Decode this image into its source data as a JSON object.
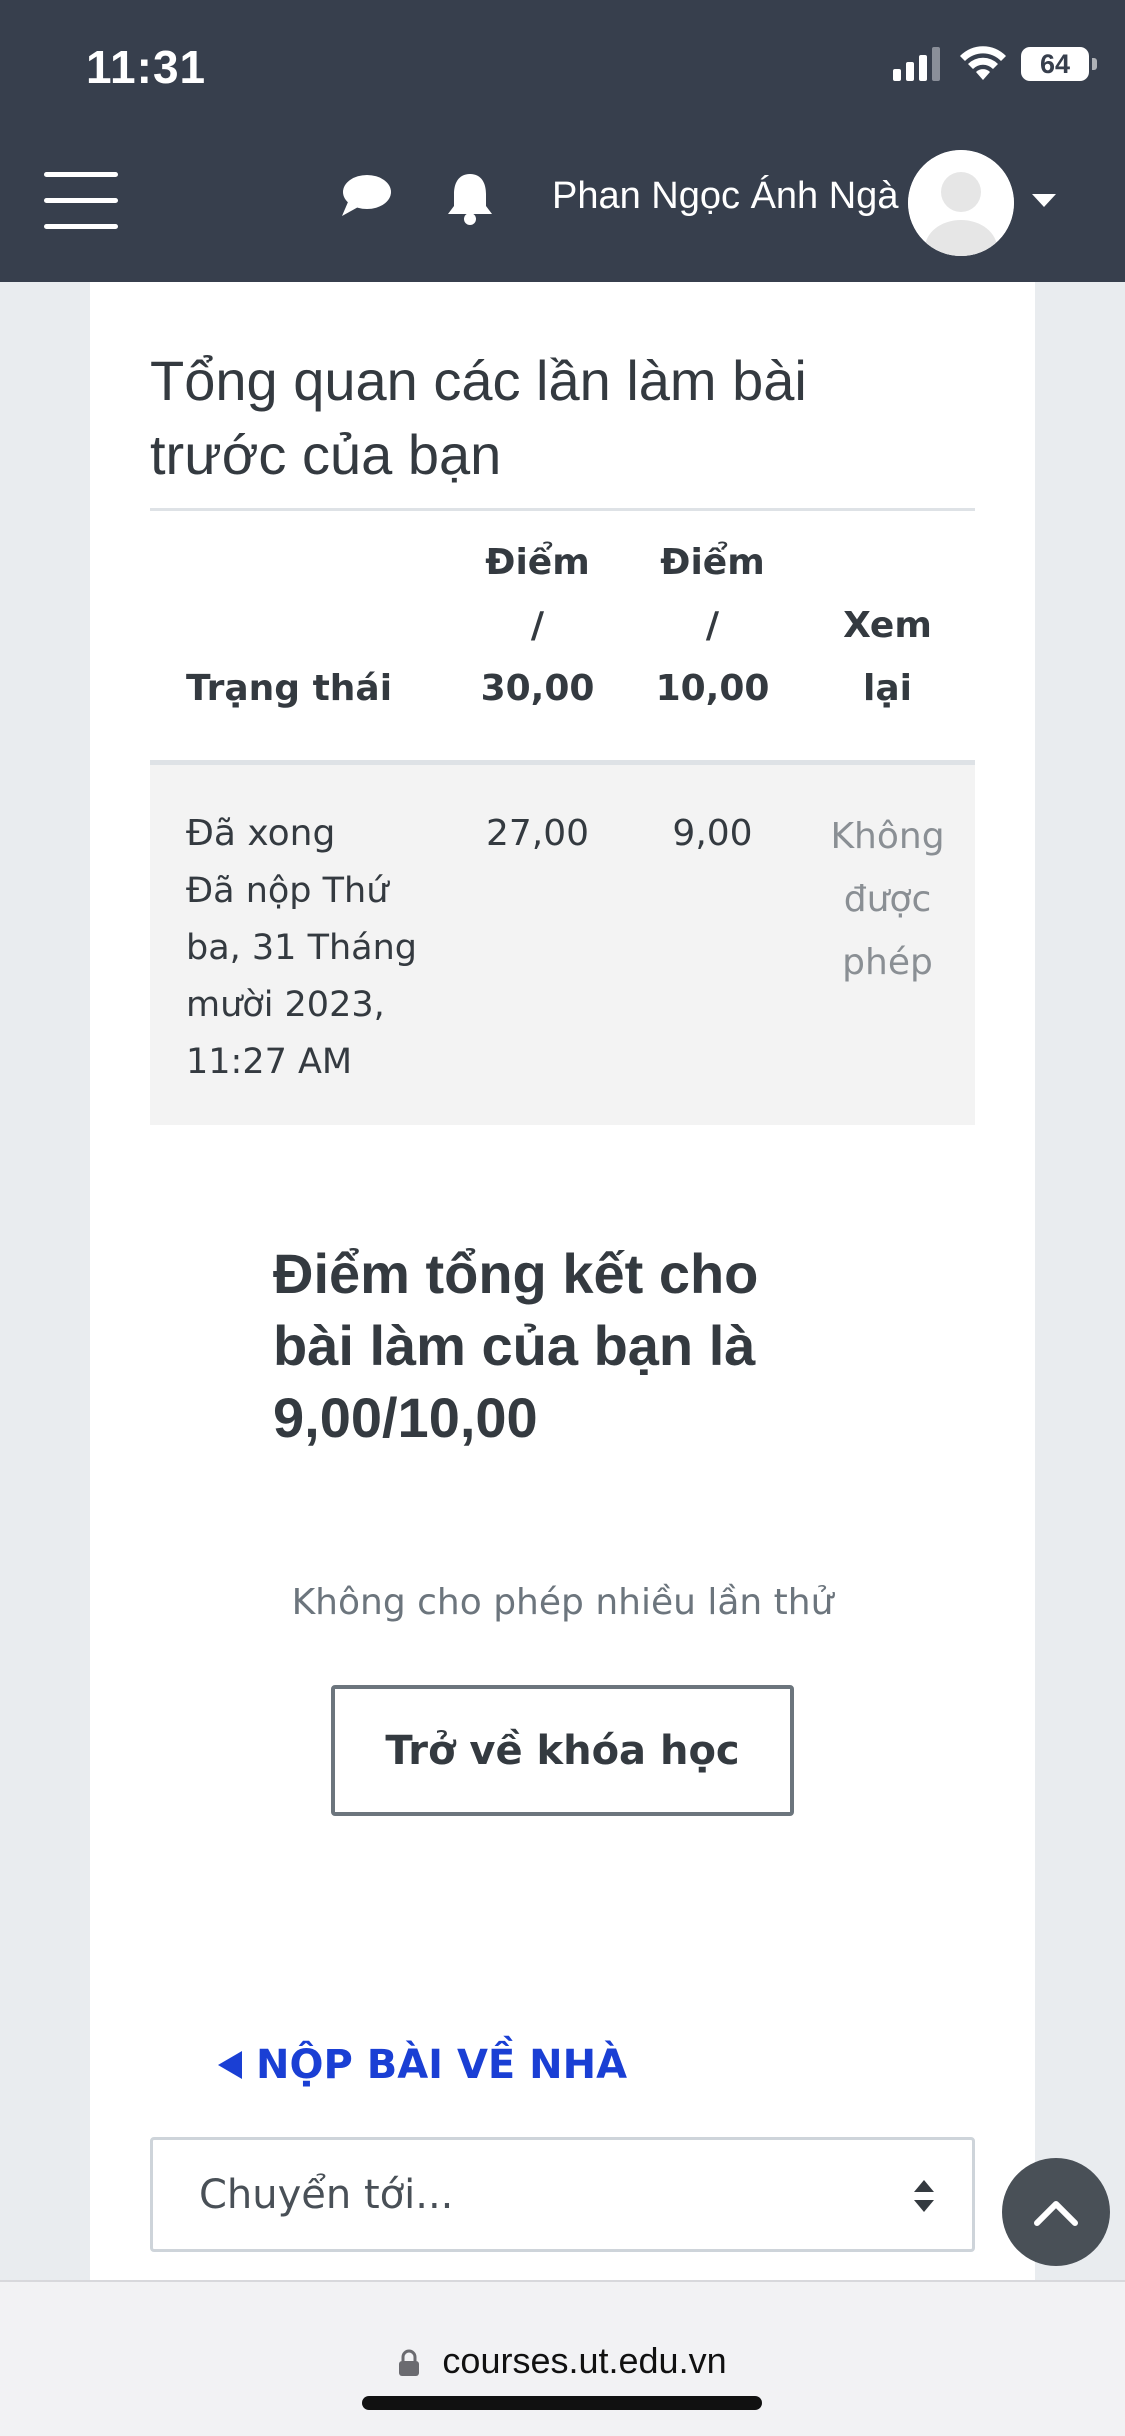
{
  "status_bar": {
    "time": "11:31",
    "battery": "64"
  },
  "header": {
    "user_name": "Phan Ngọc Ánh Ngà"
  },
  "overview": {
    "title": "Tổng quan các lần làm bài trước của bạn",
    "columns": {
      "state": "Trạng thái",
      "grade30": [
        "Điểm",
        "/",
        "30,00"
      ],
      "grade10": [
        "Điểm",
        "/",
        "10,00"
      ],
      "review": [
        "Xem",
        "lại"
      ]
    },
    "rows": [
      {
        "state": "Đã xong",
        "submitted": "Đã nộp Thứ ba, 31 Tháng mười 2023, 11:27 AM",
        "grade30": "27,00",
        "grade10": "9,00",
        "review": [
          "Không",
          "được",
          "phép"
        ]
      }
    ]
  },
  "final_grade": "Điểm tổng kết cho bài làm của bạn là 9,00/10,00",
  "no_retake": "Không cho phép nhiều lần thử",
  "back_button": "Trở về khóa học",
  "prev_activity": "NỘP BÀI VỀ NHÀ",
  "jump_to": {
    "value": "Chuyển tới..."
  },
  "url": "courses.ut.edu.vn",
  "colors": {
    "header_bg": "#373f4d",
    "link": "#1a3fd4",
    "accent_gray": "#6c757d"
  }
}
